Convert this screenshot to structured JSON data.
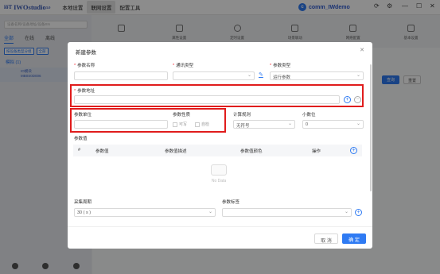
{
  "app": {
    "logo_mark": "iōT",
    "name": "IWOstudio",
    "version": "3.0",
    "nav": [
      "本地设置",
      "联网设置",
      "配置工具"
    ],
    "user": "comm_IWdemo",
    "user_initial": "c"
  },
  "sidebar": {
    "search_placeholder": "设备名称/设备地址/设备SN",
    "tabs": [
      "全部",
      "在线",
      "离线"
    ],
    "filters": [
      "按设备类型分组",
      "全部"
    ],
    "group_label": "模拟 (1)",
    "device_name": "IO模块",
    "device_sub": "MB0S0D006"
  },
  "toolbar": {
    "items": [
      "",
      "属性设置",
      "定时设置",
      "场景联动",
      "网络配置",
      "基本设置"
    ]
  },
  "main": {
    "btn_query": "查询",
    "btn_reset": "重置"
  },
  "dialog": {
    "title": "新建参数",
    "fields": {
      "param_name": {
        "label": "参数名称",
        "value": ""
      },
      "comm_type": {
        "label": "通讯类型",
        "value": ""
      },
      "param_type": {
        "label": "参数类型",
        "value": "运行参数"
      },
      "param_address": {
        "label": "参数地址",
        "value": ""
      },
      "param_unit": {
        "label": "参数单位",
        "value": ""
      },
      "param_nature": {
        "label": "参数性质",
        "options": [
          "可写",
          "自检"
        ]
      },
      "calc_rule": {
        "label": "计算规则",
        "value": "无符号"
      },
      "decimals": {
        "label": "小数位",
        "value": "0"
      },
      "param_values": {
        "label": "参数值"
      },
      "collect_period": {
        "label": "采集周期",
        "value": "30 ( s )"
      },
      "param_tags": {
        "label": "参数标签",
        "value": ""
      }
    },
    "table": {
      "headers": [
        "#",
        "参数值",
        "参数值描述",
        "参数值颜色",
        "操作"
      ],
      "empty_text": "No Data"
    },
    "buttons": {
      "cancel": "取 消",
      "confirm": "确 定"
    }
  },
  "colors": {
    "primary": "#2f7bf3",
    "highlight": "#e01c1c",
    "required": "#f5222d"
  }
}
